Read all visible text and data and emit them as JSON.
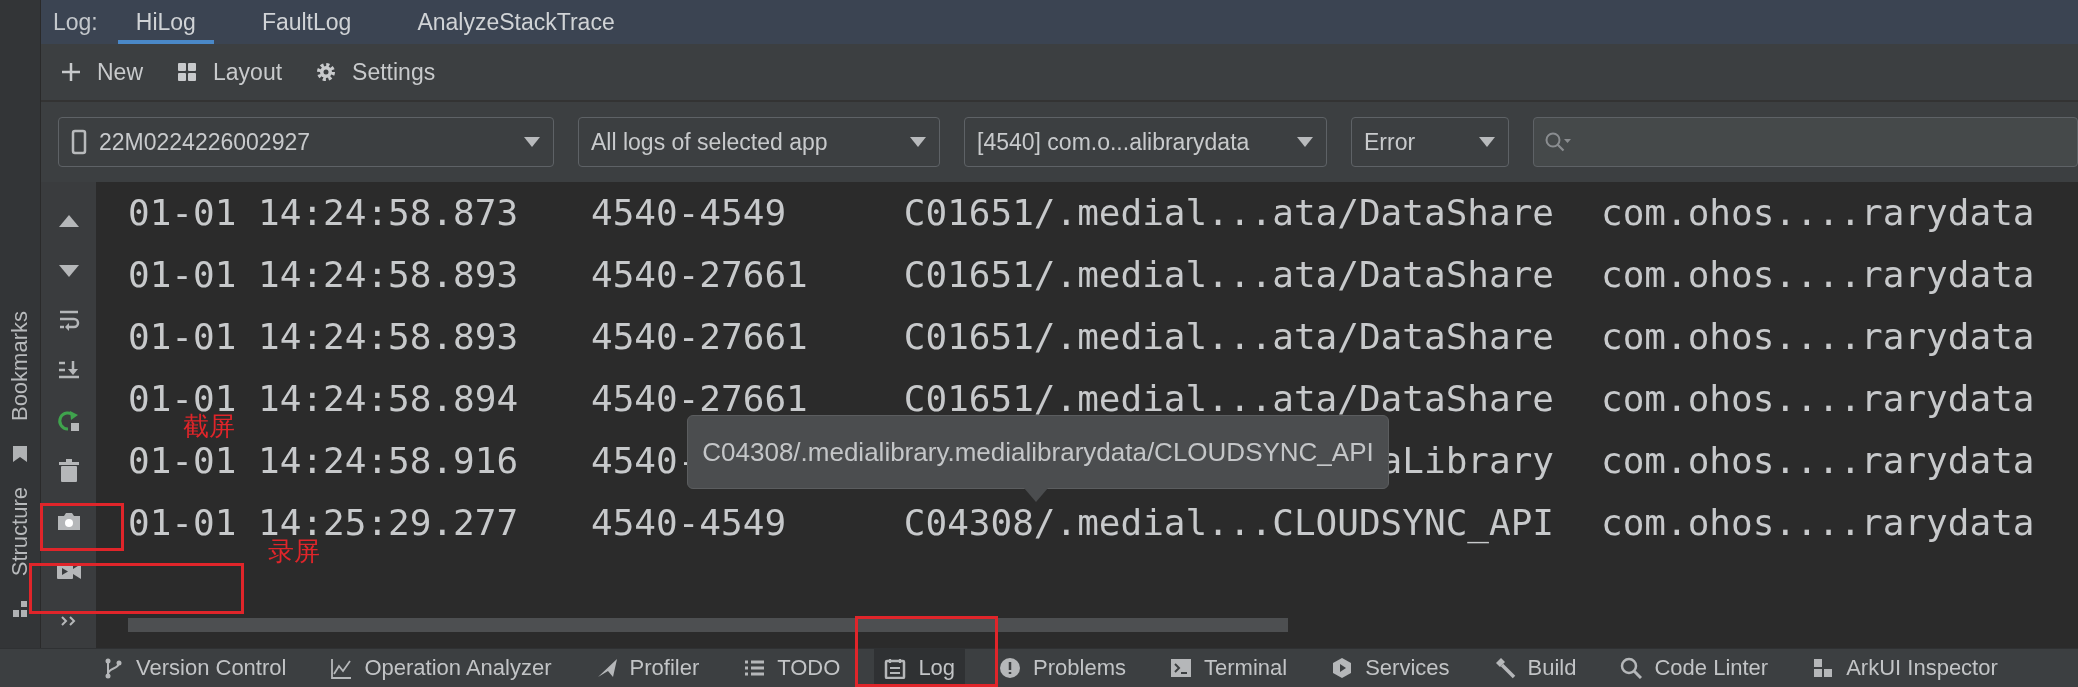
{
  "log_tabs": {
    "label": "Log:",
    "tabs": [
      {
        "label": "HiLog",
        "selected": true
      },
      {
        "label": "FaultLog",
        "selected": false
      },
      {
        "label": "AnalyzeStackTrace",
        "selected": false
      }
    ]
  },
  "toolbar": [
    {
      "kind": "new",
      "label": "New"
    },
    {
      "kind": "layout",
      "label": "Layout"
    },
    {
      "kind": "settings",
      "label": "Settings"
    }
  ],
  "filters": {
    "device": "22M0224226002927",
    "scope": "All logs of selected app",
    "process": "[4540] com.o...alibrarydata",
    "level": "Error"
  },
  "side_tool_windows": [
    "Bookmarks",
    "Structure"
  ],
  "log_rows": [
    {
      "time": "01-01 14:24:58.873",
      "pid": "4540-4549",
      "tag": "C01651/.medial...ata/DataShare",
      "package": "com.ohos....rarydata"
    },
    {
      "time": "01-01 14:24:58.893",
      "pid": "4540-27661",
      "tag": "C01651/.medial...ata/DataShare",
      "package": "com.ohos....rarydata"
    },
    {
      "time": "01-01 14:24:58.893",
      "pid": "4540-27661",
      "tag": "C01651/.medial...ata/DataShare",
      "package": "com.ohos....rarydata"
    },
    {
      "time": "01-01 14:24:58.894",
      "pid": "4540-27661",
      "tag": "C01651/.medial...ata/DataShare",
      "package": "com.ohos....rarydata"
    },
    {
      "time": "01-01 14:24:58.916",
      "pid": "4540-",
      "tag": "aLibrary",
      "package": "com.ohos....rarydata"
    },
    {
      "time": "01-01 14:25:29.277",
      "pid": "4540-4549",
      "tag": "C04308/.medial...CLOUDSYNC_API",
      "package": "com.ohos....rarydata"
    }
  ],
  "tooltip": "C04308/.medialibrary.medialibrarydata/CLOUDSYNC_API",
  "bottom_tools": [
    {
      "kind": "vcs",
      "label": "Version Control",
      "selected": false
    },
    {
      "kind": "chart",
      "label": "Operation Analyzer",
      "selected": false
    },
    {
      "kind": "profiler",
      "label": "Profiler",
      "selected": false
    },
    {
      "kind": "list",
      "label": "TODO",
      "selected": false
    },
    {
      "kind": "log",
      "label": "Log",
      "selected": true
    },
    {
      "kind": "problems",
      "label": "Problems",
      "selected": false
    },
    {
      "kind": "terminal",
      "label": "Terminal",
      "selected": false
    },
    {
      "kind": "services",
      "label": "Services",
      "selected": false
    },
    {
      "kind": "build",
      "label": "Build",
      "selected": false
    },
    {
      "kind": "linter",
      "label": "Code Linter",
      "selected": false
    },
    {
      "kind": "inspector",
      "label": "ArkUI Inspector",
      "selected": false
    }
  ],
  "annotations": [
    {
      "kind": "label",
      "text": "截屏",
      "color": "#e0252a"
    },
    {
      "kind": "label",
      "text": "录屏",
      "color": "#e0252a"
    },
    {
      "kind": "box",
      "color": "#e0252a"
    },
    {
      "kind": "box",
      "color": "#e0252a"
    },
    {
      "kind": "box",
      "color": "#e0252a"
    }
  ]
}
